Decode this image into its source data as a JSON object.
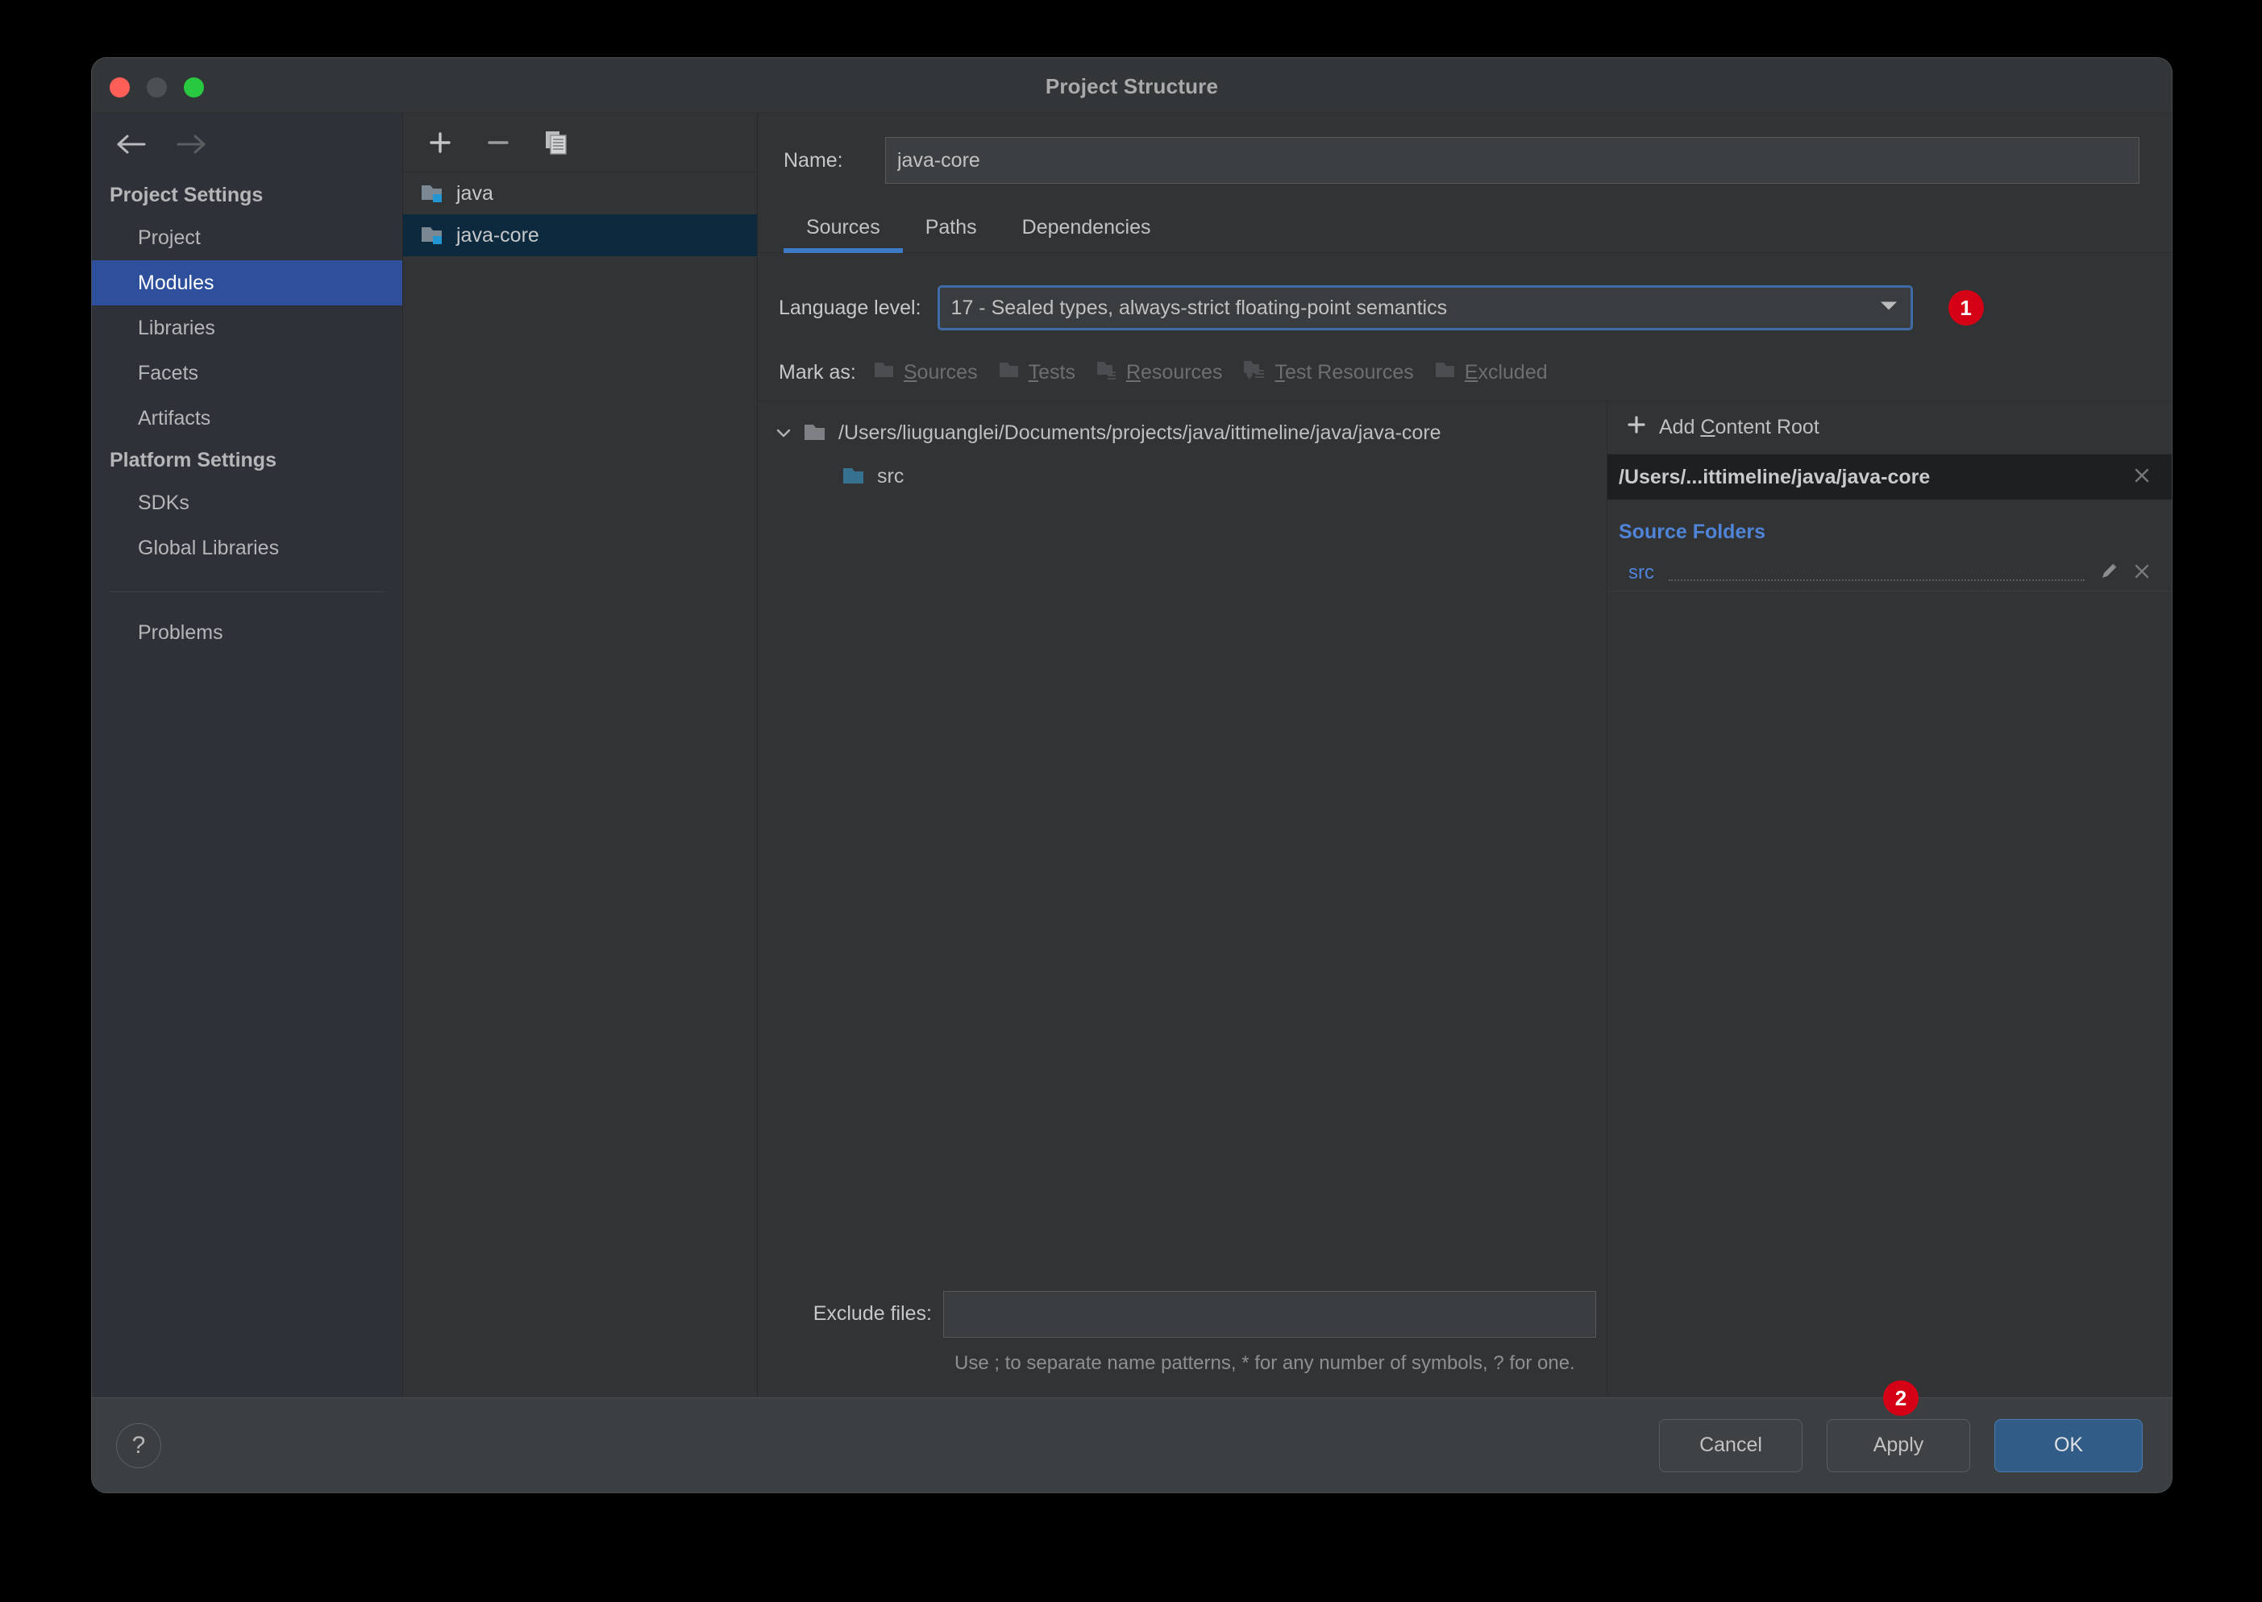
{
  "window": {
    "title": "Project Structure",
    "traffic": [
      "close-button",
      "minimize-button",
      "maximize-button"
    ]
  },
  "sidebar": {
    "back_icon": "arrow-left-icon",
    "forward_icon": "arrow-right-icon",
    "groups": [
      {
        "title": "Project Settings",
        "items": [
          {
            "label": "Project",
            "selected": false
          },
          {
            "label": "Modules",
            "selected": true
          },
          {
            "label": "Libraries",
            "selected": false
          },
          {
            "label": "Facets",
            "selected": false
          },
          {
            "label": "Artifacts",
            "selected": false
          }
        ]
      },
      {
        "title": "Platform Settings",
        "items": [
          {
            "label": "SDKs",
            "selected": false
          },
          {
            "label": "Global Libraries",
            "selected": false
          }
        ]
      }
    ],
    "problems_label": "Problems"
  },
  "module_list": {
    "toolbar": [
      {
        "name": "add-module-button",
        "glyph": "+"
      },
      {
        "name": "remove-module-button",
        "glyph": "−"
      },
      {
        "name": "copy-module-button",
        "glyph": "copy-icon"
      }
    ],
    "modules": [
      {
        "name": "java",
        "selected": false
      },
      {
        "name": "java-core",
        "selected": true
      }
    ]
  },
  "detail": {
    "name_label": "Name:",
    "name_value": "java-core",
    "name_placeholder": "",
    "tabs": [
      {
        "label": "Sources",
        "active": true
      },
      {
        "label": "Paths",
        "active": false
      },
      {
        "label": "Dependencies",
        "active": false
      }
    ],
    "language_level": {
      "label": "Language level:",
      "value": "17 - Sealed types, always-strict floating-point semantics",
      "arrow_icon": "chevron-down-icon",
      "badge": "1"
    },
    "mark_as": {
      "label": "Mark as:",
      "options": [
        {
          "label": "Sources",
          "mnemonic": "S",
          "rest": "ources",
          "icon": "folder-sources-icon"
        },
        {
          "label": "Tests",
          "mnemonic": "T",
          "rest": "ests",
          "icon": "folder-tests-icon"
        },
        {
          "label": "Resources",
          "mnemonic": "R",
          "rest": "esources",
          "icon": "folder-resources-icon"
        },
        {
          "label": "Test Resources",
          "mnemonic": "T",
          "rest": "est Resources",
          "icon": "folder-test-resources-icon"
        },
        {
          "label": "Excluded",
          "mnemonic": "E",
          "rest": "xcluded",
          "icon": "folder-excluded-icon"
        }
      ]
    },
    "tree": [
      {
        "label": "/Users/liuguanglei/Documents/projects/java/ittimeline/java/java-core",
        "level": 1,
        "expanded": true,
        "icon": "folder-grey-icon"
      },
      {
        "label": "src",
        "level": 2,
        "expanded": false,
        "icon": "folder-blue-icon"
      }
    ],
    "exclude": {
      "label": "Exclude files:",
      "value": "",
      "placeholder": "",
      "hint": "Use ; to separate name patterns, * for any number of symbols, ? for one."
    }
  },
  "root_panel": {
    "add_content_root": {
      "plus": "+",
      "pre": "Add ",
      "mnemonic": "C",
      "post": "ontent Root"
    },
    "content_root_path": "/Users/...ittimeline/java/java-core",
    "content_root_remove_icon": "close-icon",
    "source_folders_title": "Source Folders",
    "source_folders": [
      {
        "name": "src",
        "edit_icon": "pencil-icon",
        "remove_icon": "close-icon"
      }
    ]
  },
  "footer": {
    "help_glyph": "?",
    "cancel_label": "Cancel",
    "apply_label": "Apply",
    "ok_label": "OK",
    "apply_badge": "2"
  },
  "colors": {
    "accent_blue": "#3d79c4",
    "selection_blue": "#2e4f9b",
    "row_selection": "#0d293e",
    "link_blue": "#4f84d8",
    "badge_red": "#d50016",
    "window_bg": "#3c3f41",
    "panel_bg": "#313335",
    "sidebar_bg": "#2e3138",
    "titlebar_bg": "#333638"
  }
}
